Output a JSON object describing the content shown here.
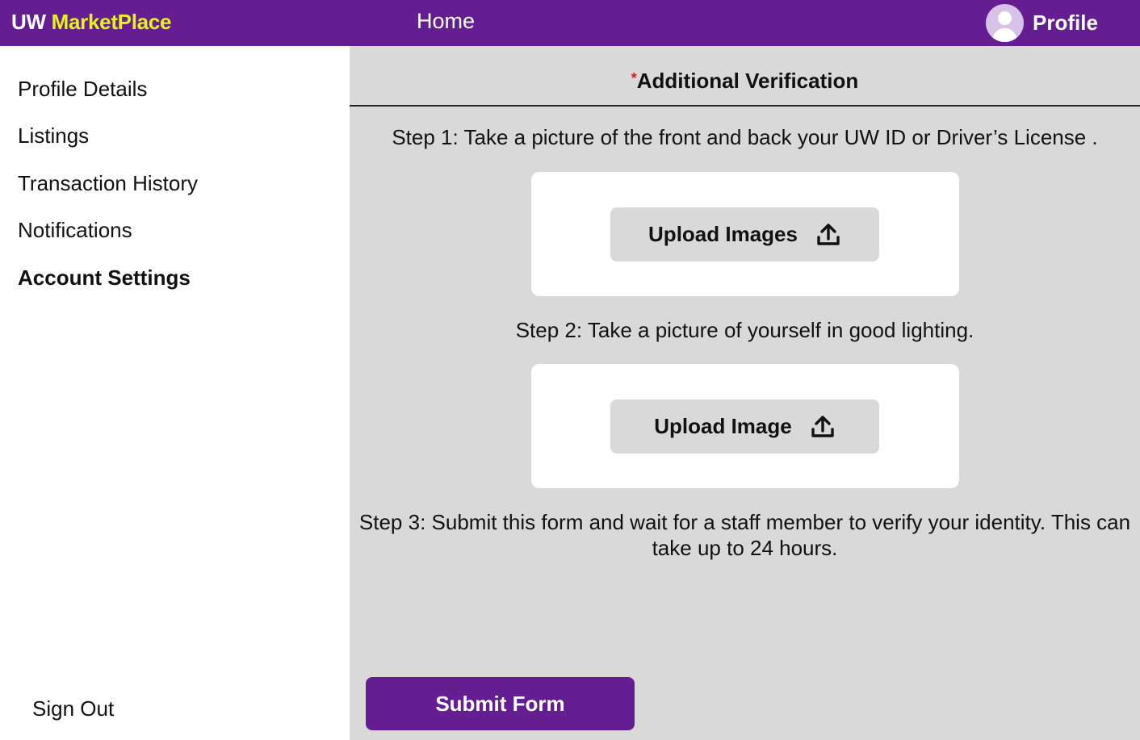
{
  "app": {
    "brand_part1": "UW",
    "brand_part2": "MarketPlace",
    "brand_colors": {
      "primary": "#641e91",
      "accent": "#e7f21a"
    }
  },
  "header": {
    "home_label": "Home",
    "profile_label": "Profile",
    "avatar_icon": "user-avatar-icon"
  },
  "sidebar": {
    "items": [
      {
        "label": "Profile Details",
        "active": false
      },
      {
        "label": "Listings",
        "active": false
      },
      {
        "label": "Transaction History",
        "active": false
      },
      {
        "label": "Notifications",
        "active": false
      },
      {
        "label": "Account Settings",
        "active": true
      }
    ],
    "signout_label": "Sign Out"
  },
  "verification": {
    "required_marker": "*",
    "title": "Additional Verification",
    "steps": [
      "Step 1: Take a picture of the front and back your UW ID or Driver’s License .",
      "Step 2: Take a picture of yourself in good lighting.",
      "Step 3: Submit this form and wait for a staff member to verify your identity. This can take up to 24 hours."
    ],
    "upload_buttons": [
      {
        "label": "Upload Images",
        "icon": "upload-icon"
      },
      {
        "label": "Upload Image",
        "icon": "upload-icon"
      }
    ],
    "submit_label": "Submit Form"
  }
}
